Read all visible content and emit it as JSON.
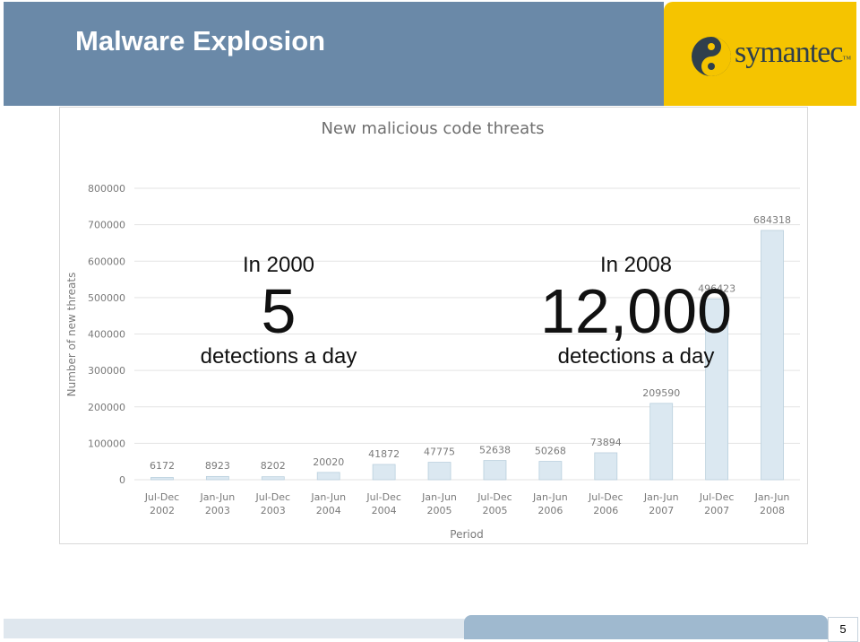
{
  "header": {
    "title": "Malware Explosion",
    "logo_text": "symantec",
    "logo_tm": "™"
  },
  "chart_data": {
    "type": "bar",
    "title": "New malicious code threats",
    "xlabel": "Period",
    "ylabel": "Number of new threats",
    "ylim": [
      0,
      800000
    ],
    "yticks": [
      0,
      100000,
      200000,
      300000,
      400000,
      500000,
      600000,
      700000,
      800000
    ],
    "grid": true,
    "categories": [
      [
        "Jul-Dec",
        "2002"
      ],
      [
        "Jan-Jun",
        "2003"
      ],
      [
        "Jul-Dec",
        "2003"
      ],
      [
        "Jan-Jun",
        "2004"
      ],
      [
        "Jul-Dec",
        "2004"
      ],
      [
        "Jan-Jun",
        "2005"
      ],
      [
        "Jul-Dec",
        "2005"
      ],
      [
        "Jan-Jun",
        "2006"
      ],
      [
        "Jul-Dec",
        "2006"
      ],
      [
        "Jan-Jun",
        "2007"
      ],
      [
        "Jul-Dec",
        "2007"
      ],
      [
        "Jan-Jun",
        "2008"
      ]
    ],
    "values": [
      6172,
      8923,
      8202,
      20020,
      41872,
      47775,
      52638,
      50268,
      73894,
      209590,
      496423,
      684318
    ]
  },
  "callouts": {
    "left": {
      "year": "In 2000",
      "number": "5",
      "caption": "detections a day"
    },
    "right": {
      "year": "In 2008",
      "number": "12,000",
      "caption": "detections a day"
    }
  },
  "footer": {
    "page_number": "5"
  },
  "colors": {
    "header": "#6a89a8",
    "logo_bg": "#f5c400",
    "bar": "#dbe8f1",
    "bar_edge": "#b9cfdd",
    "axis_text": "#7a7a7a"
  }
}
